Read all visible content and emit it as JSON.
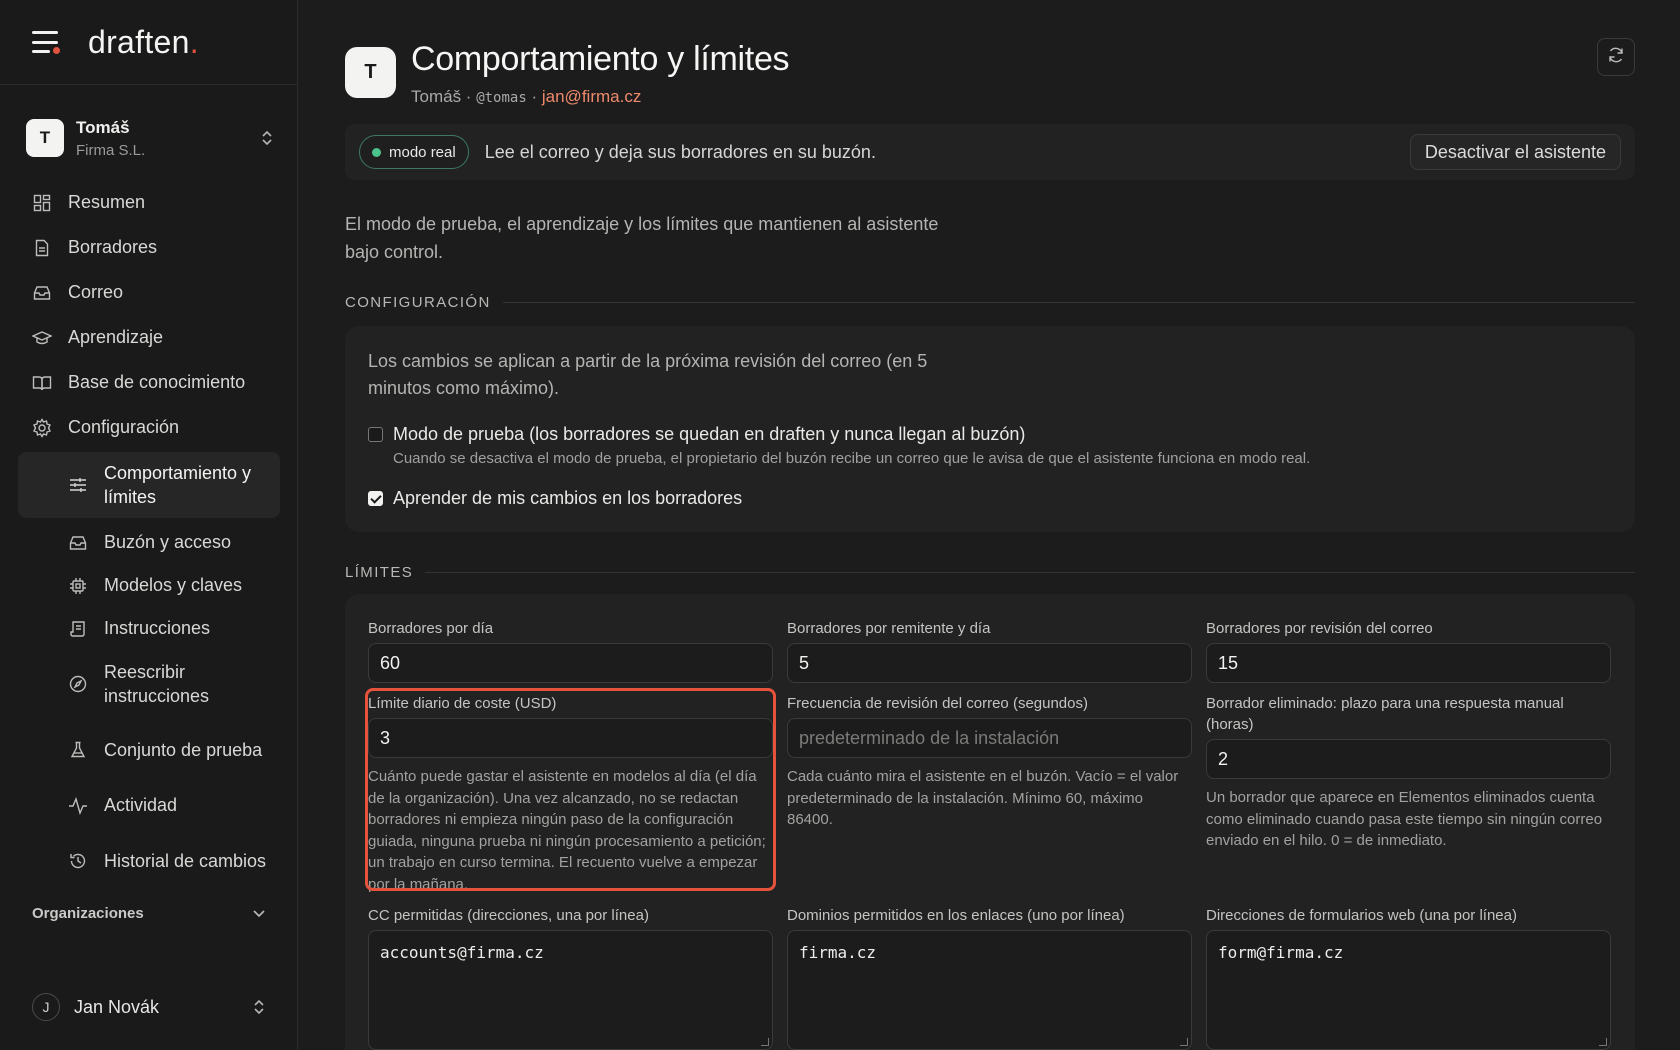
{
  "brand": {
    "logo": "draften",
    "logo_dot": "."
  },
  "account": {
    "initial": "T",
    "name": "Tomáš",
    "company": "Firma S.L."
  },
  "nav": [
    {
      "label": "Resumen",
      "icon": "dashboard-icon"
    },
    {
      "label": "Borradores",
      "icon": "document-icon"
    },
    {
      "label": "Correo",
      "icon": "inbox-icon"
    },
    {
      "label": "Aprendizaje",
      "icon": "graduation-cap-icon"
    },
    {
      "label": "Base de conocimiento",
      "icon": "book-icon"
    },
    {
      "label": "Configuración",
      "icon": "gear-icon"
    }
  ],
  "subnav": [
    {
      "label": "Comportamiento y límites",
      "icon": "sliders-icon"
    },
    {
      "label": "Buzón y acceso",
      "icon": "inbox-icon"
    },
    {
      "label": "Modelos y claves",
      "icon": "chip-icon"
    },
    {
      "label": "Instrucciones",
      "icon": "scroll-icon"
    },
    {
      "label": "Reescribir instrucciones",
      "icon": "compass-icon"
    },
    {
      "label": "Conjunto de prueba",
      "icon": "flask-icon"
    },
    {
      "label": "Actividad",
      "icon": "activity-icon"
    },
    {
      "label": "Historial de cambios",
      "icon": "history-icon"
    }
  ],
  "organizations_label": "Organizaciones",
  "user": {
    "initial": "J",
    "name": "Jan Novák"
  },
  "header": {
    "initial": "T",
    "title": "Comportamiento y límites",
    "name": "Tomáš",
    "sep": " · ",
    "handle": "@tomas",
    "email": "jan@firma.cz"
  },
  "banner": {
    "pill": "modo real",
    "text": "Lee el correo y deja sus borradores en su buzón.",
    "button": "Desactivar el asistente"
  },
  "intro": "El modo de prueba, el aprendizaje y los límites que mantienen al asistente bajo control.",
  "config": {
    "heading": "CONFIGURACIÓN",
    "note": "Los cambios se aplican a partir de la próxima revisión del correo (en 5 minutos como máximo).",
    "test_mode_label": "Modo de prueba (los borradores se quedan en draften y nunca llegan al buzón)",
    "test_mode_checked": false,
    "test_mode_help": "Cuando se desactiva el modo de prueba, el propietario del buzón recibe un correo que le avisa de que el asistente funciona en modo real.",
    "learn_label": "Aprender de mis cambios en los borradores",
    "learn_checked": true
  },
  "limits": {
    "heading": "LÍMITES",
    "drafts_per_day": {
      "label": "Borradores por día",
      "value": "60"
    },
    "drafts_per_sender": {
      "label": "Borradores por remitente y día",
      "value": "5"
    },
    "drafts_per_check": {
      "label": "Borradores por revisión del correo",
      "value": "15"
    },
    "cost_limit": {
      "label": "Límite diario de coste (USD)",
      "value": "3",
      "help": "Cuánto puede gastar el asistente en modelos al día (el día de la organización). Una vez alcanzado, no se redactan borradores ni empieza ningún paso de la configuración guiada, ninguna prueba ni ningún procesamiento a petición; un trabajo en curso termina. El recuento vuelve a empezar por la mañana."
    },
    "check_frequency": {
      "label": "Frecuencia de revisión del correo (segundos)",
      "placeholder": "predeterminado de la instalación",
      "help": "Cada cuánto mira el asistente en el buzón. Vacío = el valor predeterminado de la instalación. Mínimo 60, máximo 86400."
    },
    "deleted_draft": {
      "label": "Borrador eliminado: plazo para una respuesta manual (horas)",
      "value": "2",
      "help": "Un borrador que aparece en Elementos eliminados cuenta como eliminado cuando pasa este tiempo sin ningún correo enviado en el hilo. 0 = de inmediato."
    },
    "cc_allowed": {
      "label": "CC permitidas (direcciones, una por línea)",
      "value": "accounts@firma.cz"
    },
    "domains_allowed": {
      "label": "Dominios permitidos en los enlaces (uno por línea)",
      "value": "firma.cz"
    },
    "webform_addresses": {
      "label": "Direcciones de formularios web (una por línea)",
      "value": "form@firma.cz"
    }
  },
  "colors": {
    "accent": "#e0533f",
    "live": "#4cc38a",
    "email": "#ee8a6c",
    "highlight": "#e5533c"
  }
}
